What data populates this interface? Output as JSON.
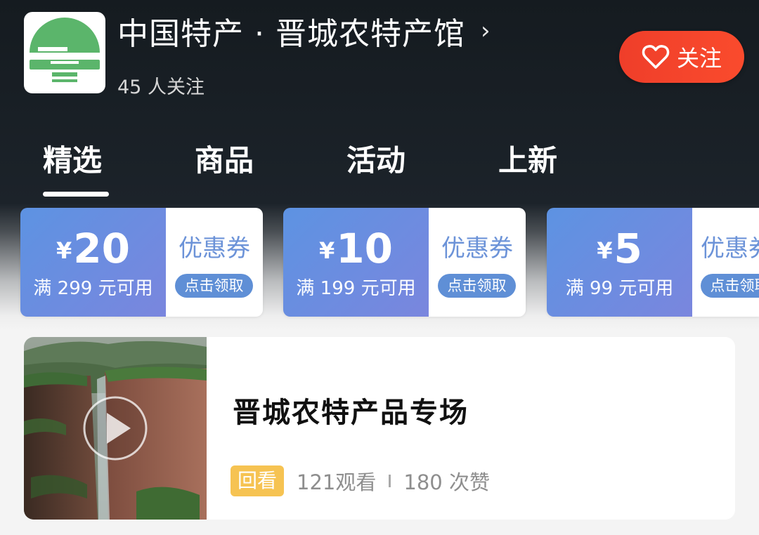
{
  "store": {
    "title": "中国特产 · 晋城农特产馆",
    "followers": "45 人关注",
    "follow_label": "关注"
  },
  "tabs": [
    {
      "label": "精选",
      "active": true
    },
    {
      "label": "商品",
      "active": false
    },
    {
      "label": "活动",
      "active": false
    },
    {
      "label": "上新",
      "active": false
    }
  ],
  "coupons": [
    {
      "currency": "¥",
      "amount": "20",
      "condition": "满 299 元可用",
      "label": "优惠券",
      "action": "点击领取"
    },
    {
      "currency": "¥",
      "amount": "10",
      "condition": "满 199 元可用",
      "label": "优惠券",
      "action": "点击领取"
    },
    {
      "currency": "¥",
      "amount": "5",
      "condition": "满 99 元可用",
      "label": "优惠券",
      "action": "点击领取"
    }
  ],
  "live_card": {
    "title": "晋城农特产品专场",
    "badge": "回看",
    "views": "121观看",
    "likes": "180 次赞"
  },
  "colors": {
    "follow_button": "#f04a2d",
    "coupon_blue": "#6b8fe0",
    "badge_yellow": "#f6c352",
    "logo_green": "#5bb56b"
  }
}
